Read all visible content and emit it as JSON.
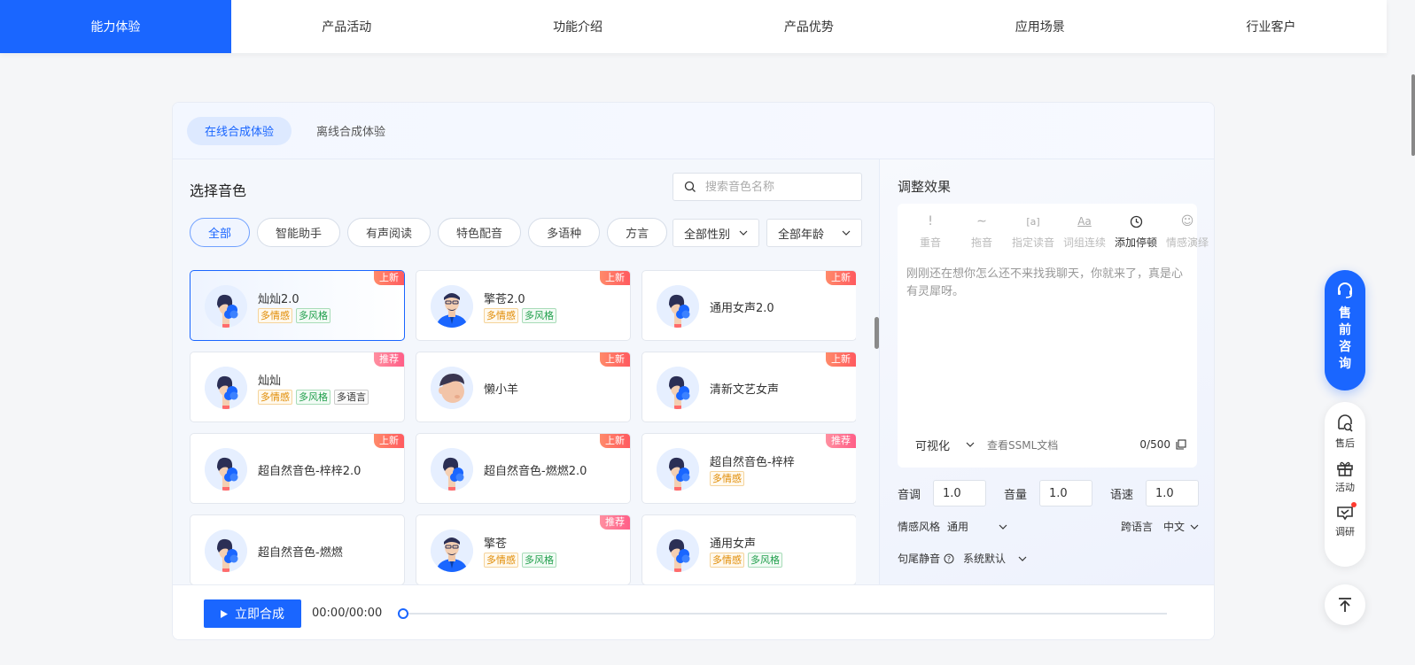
{
  "nav": {
    "ghost_title": "能力体验",
    "items": [
      {
        "label": "能力体验",
        "active": true
      },
      {
        "label": "产品活动"
      },
      {
        "label": "功能介绍"
      },
      {
        "label": "产品优势"
      },
      {
        "label": "应用场景"
      },
      {
        "label": "行业客户"
      }
    ]
  },
  "mode_tabs": [
    "在线合成体验",
    "离线合成体验"
  ],
  "voice": {
    "title": "选择音色",
    "search_placeholder": "搜索音色名称",
    "categories": [
      "全部",
      "智能助手",
      "有声阅读",
      "特色配音",
      "多语种",
      "方言"
    ],
    "gender_filter": "全部性别",
    "age_filter": "全部年龄",
    "cards": [
      {
        "name": "灿灿2.0",
        "badge": "上新",
        "tags": [
          "多情感",
          "多风格"
        ]
      },
      {
        "name": "擎苍2.0",
        "badge": "上新",
        "tags": [
          "多情感",
          "多风格"
        ]
      },
      {
        "name": "通用女声2.0",
        "badge": "上新",
        "tags": []
      },
      {
        "name": "灿灿",
        "badge": "推荐",
        "tags": [
          "多情感",
          "多风格",
          "多语言"
        ]
      },
      {
        "name": "懒小羊",
        "badge": "上新",
        "tags": []
      },
      {
        "name": "清新文艺女声",
        "badge": "上新",
        "tags": []
      },
      {
        "name": "超自然音色-梓梓2.0",
        "badge": "上新",
        "tags": []
      },
      {
        "name": "超自然音色-燃燃2.0",
        "badge": "上新",
        "tags": []
      },
      {
        "name": "超自然音色-梓梓",
        "badge": "推荐",
        "tags": [
          "多情感"
        ]
      },
      {
        "name": "超自然音色-燃燃",
        "badge": "",
        "tags": []
      },
      {
        "name": "擎苍",
        "badge": "推荐",
        "tags": [
          "多情感",
          "多风格"
        ]
      },
      {
        "name": "通用女声",
        "badge": "",
        "tags": [
          "多情感",
          "多风格"
        ]
      }
    ]
  },
  "adjust": {
    "title": "调整效果",
    "tools": [
      "重音",
      "拖音",
      "指定读音",
      "词组连续",
      "添加停顿",
      "情感演绎"
    ],
    "text": "刚刚还在想你怎么还不来找我聊天，你就来了，真是心有灵犀呀。",
    "visualize_label": "可视化",
    "ssml_link": "查看SSML文档",
    "char_count": "0/500",
    "pitch_label": "音调",
    "pitch_value": "1.0",
    "volume_label": "音量",
    "volume_value": "1.0",
    "speed_label": "语速",
    "speed_value": "1.0",
    "emotion_label": "情感风格",
    "emotion_value": "通用",
    "cross_lang_label": "跨语言",
    "cross_lang_value": "中文",
    "tail_silence_label": "句尾静音",
    "tail_silence_value": "系统默认"
  },
  "player": {
    "synth_label": "立即合成",
    "time": "00:00/00:00",
    "progress": 0
  },
  "float": {
    "consult": "售前咨询",
    "tools": [
      "售后",
      "活动",
      "调研"
    ]
  },
  "colors": {
    "primary": "#1a66ff",
    "badge_new": "#ff5a5f",
    "tag_emotion": "#e08a00",
    "tag_style": "#1e9e4a"
  }
}
